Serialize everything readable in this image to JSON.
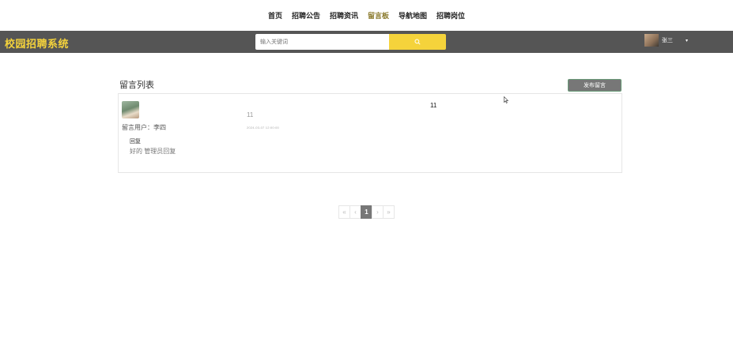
{
  "nav": {
    "items": [
      {
        "label": "首页"
      },
      {
        "label": "招聘公告"
      },
      {
        "label": "招聘资讯"
      },
      {
        "label": "留言板"
      },
      {
        "label": "导航地图"
      },
      {
        "label": "招聘岗位"
      }
    ],
    "active_index": 3
  },
  "header": {
    "logo": "校园招聘系统",
    "search_placeholder": "输入关键词",
    "search_icon": "search-icon",
    "user_name": "张三",
    "user_caret": "▾"
  },
  "colors": {
    "accent": "#f5d33b",
    "header_bg": "#555555",
    "active_nav": "#8a7a2c"
  },
  "main": {
    "title": "留言列表",
    "post_button": "发布留言",
    "messages": [
      {
        "user_label": "留言用户：李四",
        "title": "11",
        "content": "11",
        "time": "2024-03-07 12:00:00",
        "reply_title": "回复",
        "reply_text": "好的 管理员回复"
      }
    ]
  },
  "pagination": {
    "first": "«",
    "prev": "‹",
    "current": "1",
    "next": "›",
    "last": "»"
  }
}
